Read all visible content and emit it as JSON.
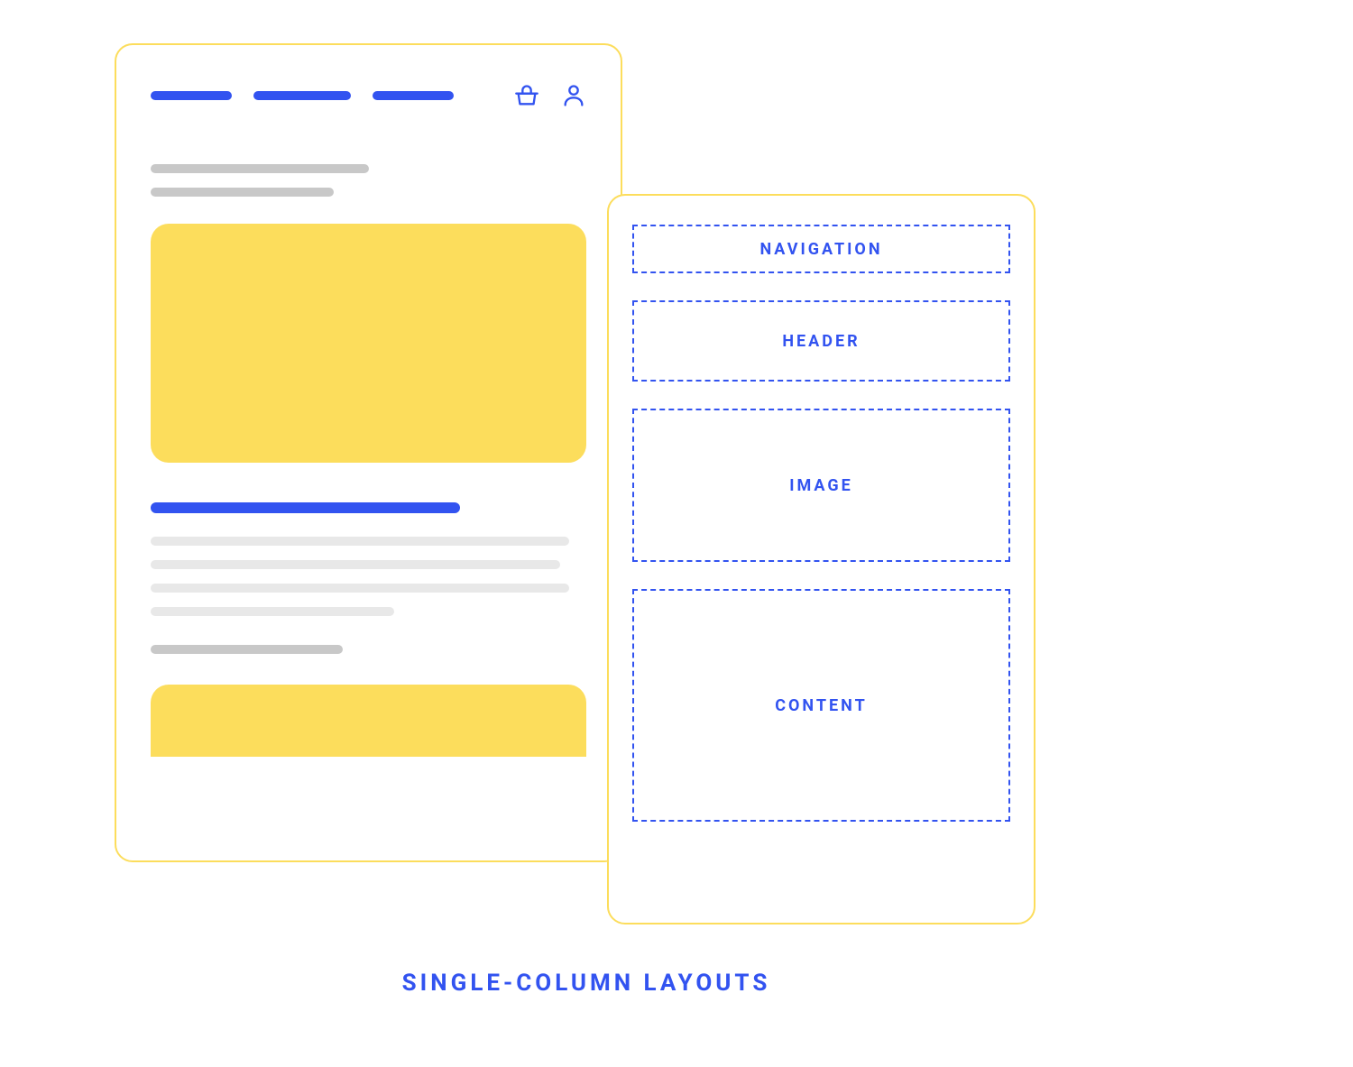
{
  "caption": "SINGLE-COLUMN LAYOUTS",
  "schematic": {
    "sections": [
      {
        "label": "NAVIGATION"
      },
      {
        "label": "HEADER"
      },
      {
        "label": "IMAGE"
      },
      {
        "label": "CONTENT"
      }
    ]
  },
  "wireframe": {
    "nav_icons": [
      "basket-icon",
      "user-icon"
    ]
  },
  "colors": {
    "accent": "#3253F0",
    "highlight": "#FCDD5C",
    "muted": "#C8C8C8",
    "faint": "#E8E8E8"
  }
}
